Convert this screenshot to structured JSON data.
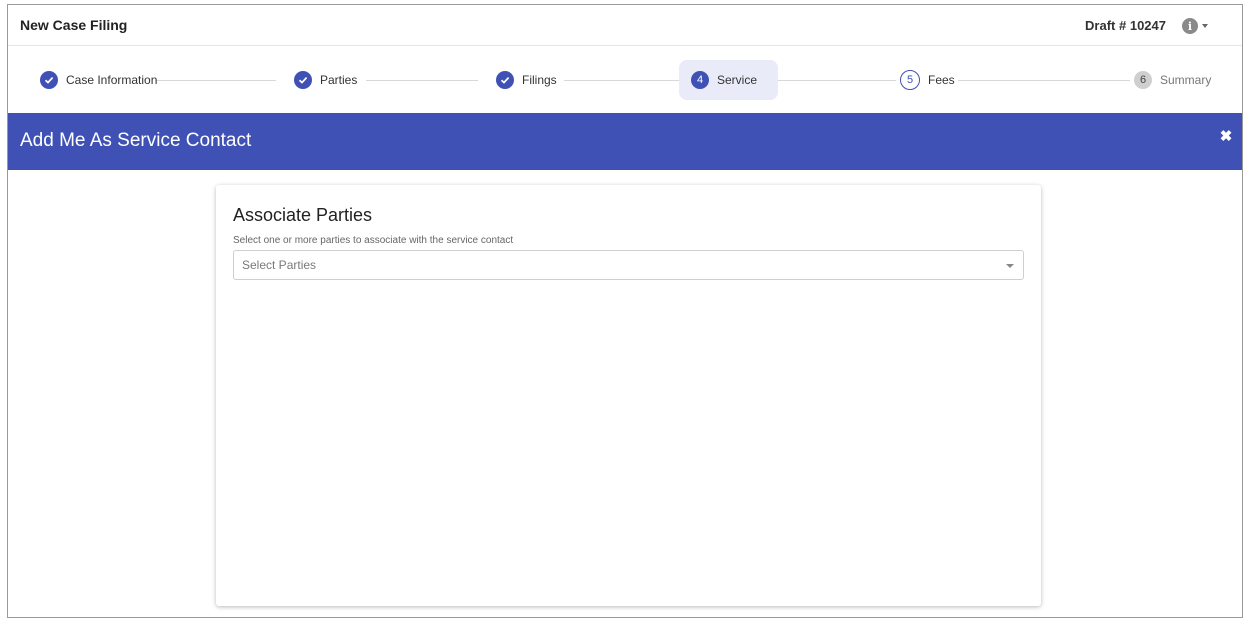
{
  "header": {
    "title": "New Case Filing",
    "draft": "Draft # 10247",
    "info_icon": "info-icon"
  },
  "stepper": {
    "steps": [
      {
        "label": "Case Information",
        "status": "complete"
      },
      {
        "label": "Parties",
        "status": "complete"
      },
      {
        "label": "Filings",
        "status": "complete"
      },
      {
        "label": "Service",
        "number": "4",
        "status": "active"
      },
      {
        "label": "Fees",
        "number": "5",
        "status": "upcoming"
      },
      {
        "label": "Summary",
        "number": "6",
        "status": "disabled"
      }
    ]
  },
  "banner": {
    "title": "Add Me As Service Contact",
    "close_icon": "close-icon"
  },
  "card": {
    "title": "Associate Parties",
    "subtitle": "Select one or more parties to associate with the service contact",
    "select_placeholder": "Select Parties"
  },
  "colors": {
    "accent": "#3f51b5",
    "active_step_bg": "#e9ecf8"
  }
}
